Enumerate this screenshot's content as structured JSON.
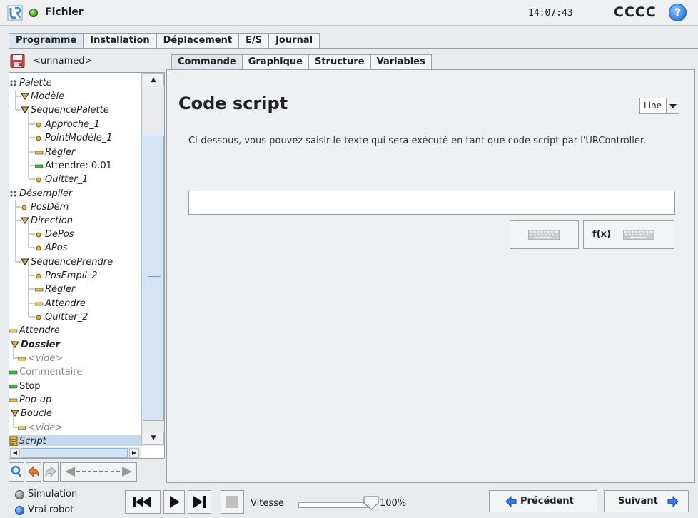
{
  "topbar": {
    "file_menu": "Fichier",
    "time": "14:07:43",
    "robot_name": "CCCC",
    "help_icon": "help-icon",
    "help_glyph": "?"
  },
  "main_tabs": [
    {
      "label": "Programme",
      "active": true
    },
    {
      "label": "Installation",
      "active": false
    },
    {
      "label": "Déplacement",
      "active": false
    },
    {
      "label": "E/S",
      "active": false
    },
    {
      "label": "Journal",
      "active": false
    }
  ],
  "program": {
    "name": "<unnamed>"
  },
  "tree": [
    {
      "label": "Palette",
      "icon": "palette",
      "style": "italic"
    },
    {
      "label": "Modèle",
      "icon": "triangle",
      "style": "italic"
    },
    {
      "label": "SéquencePalette",
      "icon": "triangle",
      "style": "italic"
    },
    {
      "label": "Approche_1",
      "icon": "waypoint",
      "style": "italic"
    },
    {
      "label": "PointModèle_1",
      "icon": "waypoint",
      "style": "italic"
    },
    {
      "label": "Régler",
      "icon": "bar-yellow",
      "style": "italic"
    },
    {
      "label": "Attendre: 0.01",
      "icon": "bar-green",
      "style": "normal"
    },
    {
      "label": "Quitter_1",
      "icon": "waypoint",
      "style": "italic"
    },
    {
      "label": "Désempiler",
      "icon": "palette",
      "style": "italic"
    },
    {
      "label": "PosDém",
      "icon": "waypoint",
      "style": "italic"
    },
    {
      "label": "Direction",
      "icon": "triangle",
      "style": "italic"
    },
    {
      "label": "DePos",
      "icon": "waypoint",
      "style": "italic"
    },
    {
      "label": "APos",
      "icon": "waypoint",
      "style": "italic"
    },
    {
      "label": "SéquencePrendre",
      "icon": "triangle",
      "style": "italic"
    },
    {
      "label": "PosEmpil_2",
      "icon": "waypoint",
      "style": "italic"
    },
    {
      "label": "Régler",
      "icon": "bar-yellow",
      "style": "italic"
    },
    {
      "label": "Attendre",
      "icon": "bar-yellow",
      "style": "italic"
    },
    {
      "label": "Quitter_2",
      "icon": "waypoint",
      "style": "italic"
    },
    {
      "label": "Attendre",
      "icon": "bar-yellow",
      "style": "italic"
    },
    {
      "label": "Dossier",
      "icon": "triangle",
      "style": "bold-italic"
    },
    {
      "label": "<vide>",
      "icon": "bar-yellow",
      "style": "muted-italic"
    },
    {
      "label": "Commentaire",
      "icon": "bar-green",
      "style": "muted"
    },
    {
      "label": "Stop",
      "icon": "bar-green",
      "style": "normal"
    },
    {
      "label": "Pop-up",
      "icon": "bar-yellow",
      "style": "italic"
    },
    {
      "label": "Boucle",
      "icon": "triangle",
      "style": "italic"
    },
    {
      "label": "<vide>",
      "icon": "bar-yellow",
      "style": "muted-italic"
    },
    {
      "label": "Script",
      "icon": "script",
      "style": "italic-selected"
    }
  ],
  "toolbar_icons": [
    "search-icon",
    "undo-icon",
    "redo-icon",
    "move-arrow-icon"
  ],
  "sub_tabs": [
    {
      "label": "Commande",
      "active": true
    },
    {
      "label": "Graphique",
      "active": false
    },
    {
      "label": "Structure",
      "active": false
    },
    {
      "label": "Variables",
      "active": false
    }
  ],
  "command": {
    "title": "Code script",
    "mode_select": "Line",
    "description": "Ci-dessous, vous pouvez saisir le texte qui sera exécuté en tant que code script par l'URController.",
    "script_value": "",
    "fx_label": "f(x)"
  },
  "bottom": {
    "simulation_label": "Simulation",
    "real_robot_label": "Vrai robot",
    "speed_label": "Vitesse",
    "speed_value": "100%",
    "speed_fraction": 1.0,
    "prev_label": "Précédent",
    "next_label": "Suivant"
  },
  "colors": {
    "accent_blue": "#2c7fe0",
    "active_tab": "#dfe6ee",
    "selection": "#c5d8ee",
    "bar_green": "#3cc23c",
    "bar_yellow": "#e6c84a",
    "waypoint_yellow": "#e3b83a"
  }
}
